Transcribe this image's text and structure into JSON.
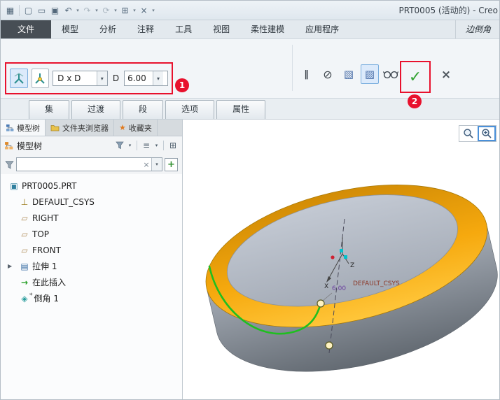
{
  "title_bar": {
    "title": "PRT0005 (活动的) - Creo",
    "quick_icons": [
      {
        "name": "window-grid-icon",
        "glyph": "▦"
      },
      {
        "name": "new-icon",
        "glyph": "▢"
      },
      {
        "name": "open-icon",
        "glyph": "▭"
      },
      {
        "name": "save-icon",
        "glyph": "▣"
      },
      {
        "name": "undo-icon",
        "glyph": "↶"
      },
      {
        "name": "redo-icon",
        "glyph": "↷"
      },
      {
        "name": "regenerate-icon",
        "glyph": "⟳"
      },
      {
        "name": "windows-icon",
        "glyph": "⊞"
      },
      {
        "name": "close-icon",
        "glyph": "×"
      },
      {
        "name": "customize-icon",
        "glyph": "▾"
      }
    ]
  },
  "ribbon_tabs": {
    "file": "文件",
    "model": "模型",
    "analysis": "分析",
    "annotate": "注释",
    "tools": "工具",
    "view": "视图",
    "flexible_modeling": "柔性建模",
    "applications": "应用程序",
    "context": "边倒角"
  },
  "dashboard": {
    "scheme_value": "D x D",
    "dim_label": "D",
    "dim_value": "6.00",
    "badge_1": "1",
    "badge_2": "2",
    "pause_glyph": "‖",
    "no_preview_glyph": "⊘",
    "preview_attached_glyph": "▧",
    "preview_geometry_glyph": "▨",
    "check_glyph": "✓",
    "cancel_glyph": "×"
  },
  "subtabs": {
    "sets": "集",
    "transitions": "过渡",
    "pieces": "段",
    "options": "选项",
    "properties": "属性"
  },
  "left_panel": {
    "tabs": {
      "model_tree": "模型树",
      "folder_browser": "文件夹浏览器",
      "favorites": "收藏夹"
    },
    "header": "模型树",
    "filter_value": "",
    "tree": [
      {
        "label": "PRT0005.PRT",
        "glyph": "▣"
      },
      {
        "label": "DEFAULT_CSYS",
        "glyph": "⊥"
      },
      {
        "label": "RIGHT",
        "glyph": "▱"
      },
      {
        "label": "TOP",
        "glyph": "▱"
      },
      {
        "label": "FRONT",
        "glyph": "▱"
      },
      {
        "label": "拉伸 1",
        "glyph": "▤"
      },
      {
        "label": "在此插入",
        "glyph": "→"
      },
      {
        "label": "倒角 1",
        "glyph": "◈",
        "marker": "*"
      }
    ]
  },
  "icons": {
    "expander": "▶",
    "dropdown": "▾",
    "clear": "×",
    "plus": "+",
    "list_view": "≡",
    "columns": "⊞",
    "star": "★"
  },
  "viewport": {
    "csys_label": "DEFAULT_CSYS",
    "dimension": "6.00",
    "axis_z": "Z",
    "axis_x": "X"
  },
  "colors": {
    "annotation_red": "#e8112d",
    "check_green": "#35a435",
    "chamfer_orange": "#f6a90e",
    "edge_green": "#1fbf1f"
  }
}
